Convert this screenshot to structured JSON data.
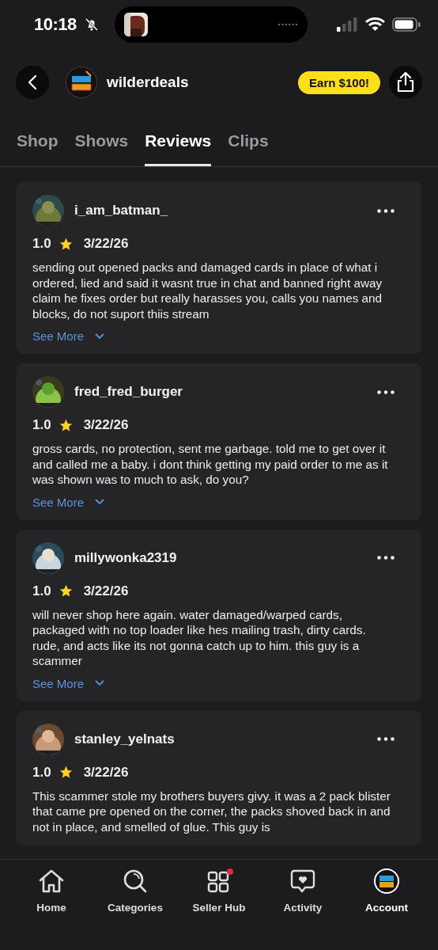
{
  "status_bar": {
    "time": "10:18",
    "silent": true
  },
  "header": {
    "shop_name": "wilderdeals",
    "promo": "Earn $100!"
  },
  "tabs": [
    {
      "label": "Shop",
      "selected": false
    },
    {
      "label": "Shows",
      "selected": false
    },
    {
      "label": "Reviews",
      "selected": true
    },
    {
      "label": "Clips",
      "selected": false
    }
  ],
  "reviews": [
    {
      "user": "i_am_batman_",
      "rating": "1.0",
      "date": "3/22/26",
      "text": "sending out opened packs and damaged cards in place of what i ordered, lied and said it wasnt true in chat and banned right away claim he fixes order but really harasses you, calls you names and blocks, do not suport thiis stream",
      "see_more": "See More"
    },
    {
      "user": "fred_fred_burger",
      "rating": "1.0",
      "date": "3/22/26",
      "text": "gross cards, no protection, sent me garbage. told me to get over it and called me a baby. i dont think getting my paid order to me as it was shown was to much to ask, do you?",
      "see_more": "See More"
    },
    {
      "user": "millywonka2319",
      "rating": "1.0",
      "date": "3/22/26",
      "text": "will never shop here again. water damaged/warped cards, packaged with no top loader like hes mailing trash, dirty cards. rude, and acts like its not gonna catch up to him. this guy is a scammer",
      "see_more": "See More"
    },
    {
      "user": "stanley_yelnats",
      "rating": "1.0",
      "date": "3/22/26",
      "text": "This scammer stole my brothers buyers givy. it was a 2 pack blister that came pre opened on the corner, the packs shoved back in and not in place, and smelled of glue. This guy is"
    }
  ],
  "nav": [
    {
      "label": "Home",
      "selected": false,
      "badge": false
    },
    {
      "label": "Categories",
      "selected": false,
      "badge": false
    },
    {
      "label": "Seller Hub",
      "selected": false,
      "badge": true
    },
    {
      "label": "Activity",
      "selected": false,
      "badge": false
    },
    {
      "label": "Account",
      "selected": true,
      "badge": false
    }
  ]
}
